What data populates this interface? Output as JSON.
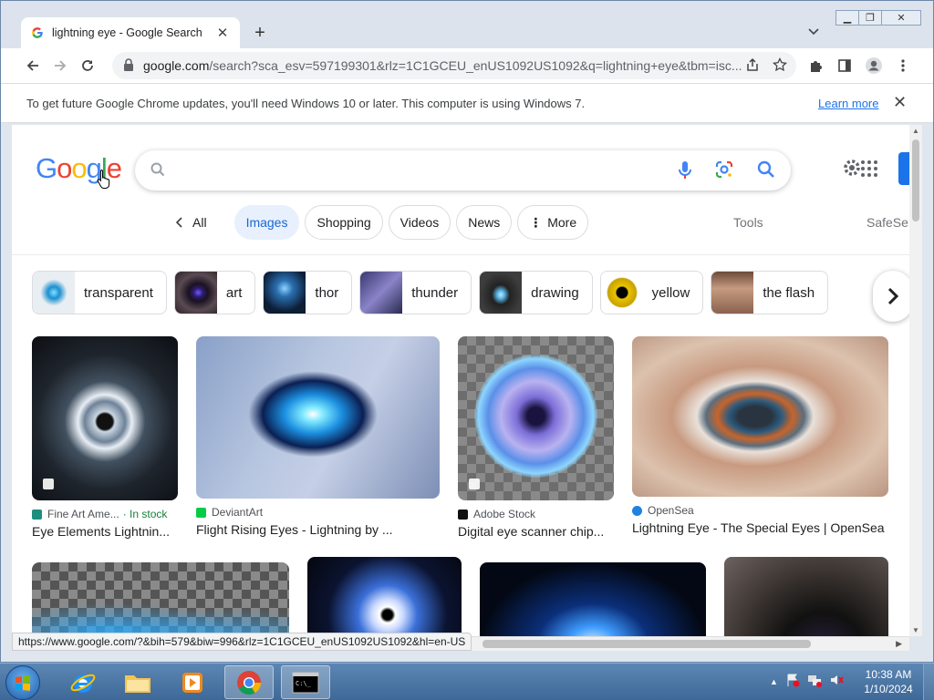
{
  "browser": {
    "tab_title": "lightning eye - Google Search",
    "url_main": "google.com",
    "url_rest": "/search?sca_esv=597199301&rlz=1C1GCEU_enUS1092US1092&q=lightning+eye&tbm=isc...",
    "status_url": "https://www.google.com/?&bih=579&biw=996&rlz=1C1GCEU_enUS1092US1092&hl=en-US"
  },
  "infobar": {
    "message": "To get future Google Chrome updates, you'll need Windows 10 or later. This computer is using Windows 7.",
    "learn_more": "Learn more"
  },
  "google": {
    "logo_letters": [
      "G",
      "o",
      "o",
      "g",
      "l",
      "e"
    ],
    "logo_colors": [
      "#4285f4",
      "#ea4335",
      "#fbbc05",
      "#4285f4",
      "#34a853",
      "#ea4335"
    ],
    "tabs": [
      {
        "label": "All",
        "selected": false
      },
      {
        "label": "Images",
        "selected": true
      },
      {
        "label": "Shopping",
        "selected": false
      },
      {
        "label": "Videos",
        "selected": false
      },
      {
        "label": "News",
        "selected": false
      },
      {
        "label": "More",
        "selected": false
      }
    ],
    "tools": "Tools",
    "safesearch": "SafeSe"
  },
  "chips": [
    {
      "label": "transparent"
    },
    {
      "label": "art"
    },
    {
      "label": "thor"
    },
    {
      "label": "thunder"
    },
    {
      "label": "drawing"
    },
    {
      "label": "yellow"
    },
    {
      "label": "the flash"
    }
  ],
  "results": [
    {
      "source": "Fine Art Ame...",
      "stock": "· In stock",
      "title": "Eye Elements Lightnin...",
      "fav_color": "#1e8e7e"
    },
    {
      "source": "DeviantArt",
      "stock": "",
      "title": "Flight Rising Eyes - Lightning by ...",
      "fav_color": "#05cc47"
    },
    {
      "source": "Adobe Stock",
      "stock": "",
      "title": "Digital eye scanner chip...",
      "fav_color": "#111111"
    },
    {
      "source": "OpenSea",
      "stock": "",
      "title": "Lightning Eye - The Special Eyes | OpenSea",
      "fav_color": "#2081e2"
    }
  ],
  "taskbar": {
    "time": "10:38 AM",
    "date": "1/10/2024"
  }
}
